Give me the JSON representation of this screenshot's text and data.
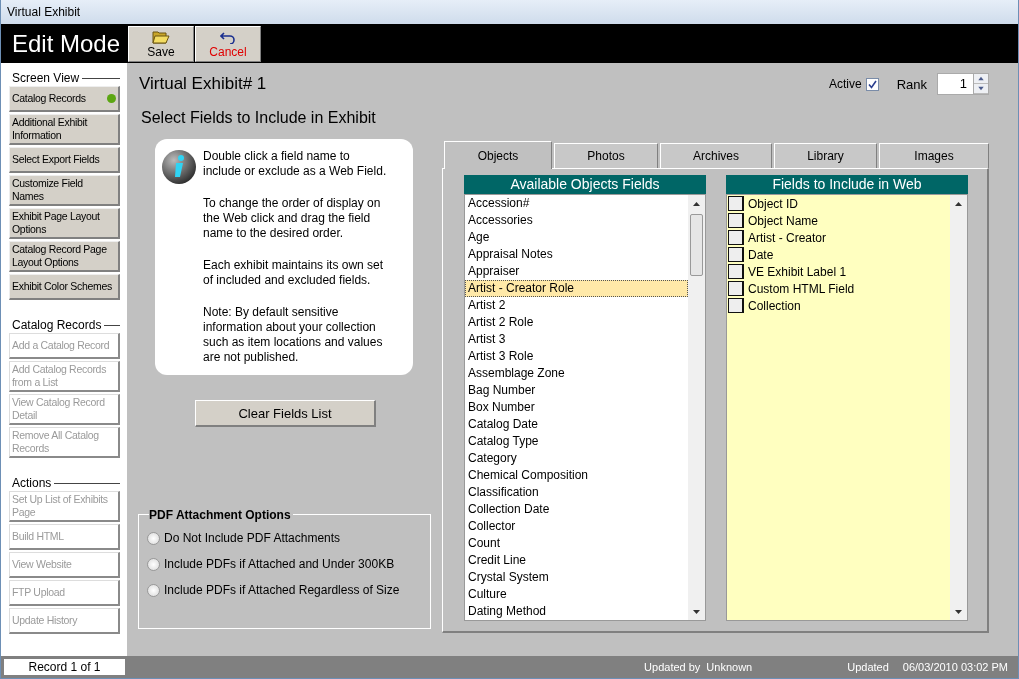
{
  "window": {
    "title": "Virtual Exhibit"
  },
  "header": {
    "mode": "Edit Mode",
    "buttons": [
      {
        "label": "Save",
        "kind": "save"
      },
      {
        "label": "Cancel",
        "kind": "cancel"
      }
    ]
  },
  "sidebar": {
    "sections": [
      {
        "title": "Screen View",
        "items": [
          {
            "label": "Catalog Records",
            "current": true,
            "disabled": false
          },
          {
            "label": "Additional Exhibit Information",
            "current": false,
            "disabled": false
          },
          {
            "label": "Select Export Fields",
            "current": false,
            "disabled": false
          },
          {
            "label": "Customize Field Names",
            "current": false,
            "disabled": false
          },
          {
            "label": "Exhibit Page Layout Options",
            "current": false,
            "disabled": false
          },
          {
            "label": "Catalog Record Page Layout Options",
            "current": false,
            "disabled": false
          },
          {
            "label": "Exhibit Color Schemes",
            "current": false,
            "disabled": false
          }
        ]
      },
      {
        "title": "Catalog Records",
        "items": [
          {
            "label": "Add a Catalog Record",
            "current": false,
            "disabled": true
          },
          {
            "label": "Add Catalog Records from a List",
            "current": false,
            "disabled": true
          },
          {
            "label": "View Catalog Record Detail",
            "current": false,
            "disabled": true
          },
          {
            "label": "Remove All Catalog Records",
            "current": false,
            "disabled": true
          }
        ]
      },
      {
        "title": "Actions",
        "items": [
          {
            "label": "Set Up List of Exhibits Page",
            "current": false,
            "disabled": true
          },
          {
            "label": "Build HTML",
            "current": false,
            "disabled": true
          },
          {
            "label": "View Website",
            "current": false,
            "disabled": true
          },
          {
            "label": "FTP Upload",
            "current": false,
            "disabled": true
          },
          {
            "label": "Update History",
            "current": false,
            "disabled": true
          }
        ]
      }
    ]
  },
  "record": {
    "title": "Virtual Exhibit# 1",
    "active_label": "Active",
    "active": true,
    "rank_label": "Rank",
    "rank": "1"
  },
  "heading": "Select Fields to Include in Exhibit",
  "info": [
    "Double click a field name to include or exclude as a Web Field.",
    "To change the order of display on the Web click and drag the field name to the desired order.",
    "Each exhibit maintains its own set of included and excluded fields.",
    "Note: By default sensitive information about your collection such as item locations and values are not published."
  ],
  "clear_button": "Clear Fields List",
  "pdf_options": {
    "title": "PDF Attachment Options",
    "options": [
      {
        "label": "Do Not Include PDF Attachments",
        "selected": false
      },
      {
        "label": "Include PDFs if Attached and Under 300KB",
        "selected": false
      },
      {
        "label": "Include PDFs if Attached Regardless of Size",
        "selected": false
      }
    ]
  },
  "tabs": [
    {
      "label": "Objects",
      "selected": true
    },
    {
      "label": "Photos",
      "selected": false
    },
    {
      "label": "Archives",
      "selected": false
    },
    {
      "label": "Library",
      "selected": false
    },
    {
      "label": "Images",
      "selected": false
    }
  ],
  "available": {
    "title": "Available Objects Fields",
    "items": [
      {
        "label": "Accession#",
        "selected": false
      },
      {
        "label": "Accessories",
        "selected": false
      },
      {
        "label": "Age",
        "selected": false
      },
      {
        "label": "Appraisal Notes",
        "selected": false
      },
      {
        "label": "Appraiser",
        "selected": false
      },
      {
        "label": "Artist - Creator Role",
        "selected": true
      },
      {
        "label": "Artist 2",
        "selected": false
      },
      {
        "label": "Artist 2 Role",
        "selected": false
      },
      {
        "label": "Artist 3",
        "selected": false
      },
      {
        "label": "Artist 3 Role",
        "selected": false
      },
      {
        "label": "Assemblage Zone",
        "selected": false
      },
      {
        "label": "Bag Number",
        "selected": false
      },
      {
        "label": "Box Number",
        "selected": false
      },
      {
        "label": "Catalog Date",
        "selected": false
      },
      {
        "label": "Catalog Type",
        "selected": false
      },
      {
        "label": "Category",
        "selected": false
      },
      {
        "label": "Chemical Composition",
        "selected": false
      },
      {
        "label": "Classification",
        "selected": false
      },
      {
        "label": "Collection Date",
        "selected": false
      },
      {
        "label": "Collector",
        "selected": false
      },
      {
        "label": "Count",
        "selected": false
      },
      {
        "label": "Credit Line",
        "selected": false
      },
      {
        "label": "Crystal System",
        "selected": false
      },
      {
        "label": "Culture",
        "selected": false
      },
      {
        "label": "Dating Method",
        "selected": false
      }
    ]
  },
  "included": {
    "title": "Fields to Include in Web",
    "items": [
      "Object ID",
      "Object Name",
      "Artist - Creator",
      "Date",
      "VE Exhibit Label 1",
      "Custom HTML Field",
      "Collection"
    ]
  },
  "status_bar": {
    "record": "Record 1 of 1",
    "updated_by_label": "Updated by",
    "updated_by": "Unknown",
    "updated_label": "Updated",
    "updated": "06/03/2010 03:02 PM"
  }
}
